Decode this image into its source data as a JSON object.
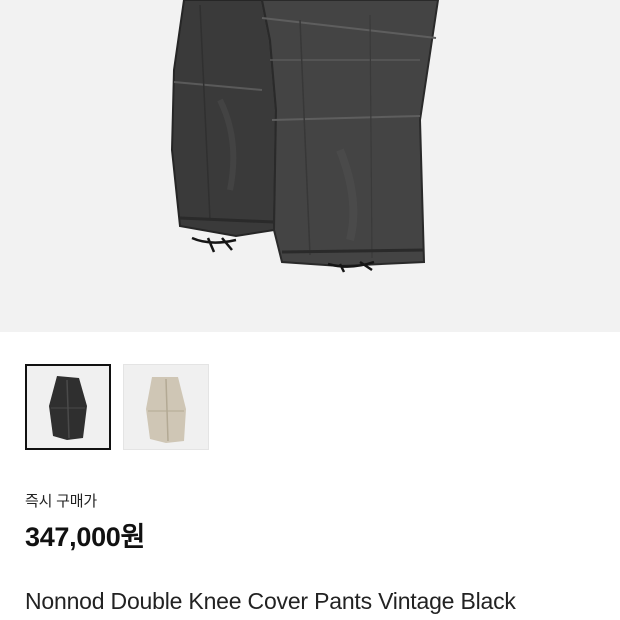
{
  "product": {
    "hero_image": "black-washed-double-knee-pants-photo",
    "thumbnails": [
      {
        "image": "black-pants-thumbnail",
        "selected": true,
        "color": "#2f2f2f"
      },
      {
        "image": "beige-pants-thumbnail",
        "selected": false,
        "color": "#cfc6b5"
      }
    ],
    "price_label": "즉시 구매가",
    "price": "347,000원",
    "title": "Nonnod Double Knee Cover Pants Vintage Black"
  }
}
